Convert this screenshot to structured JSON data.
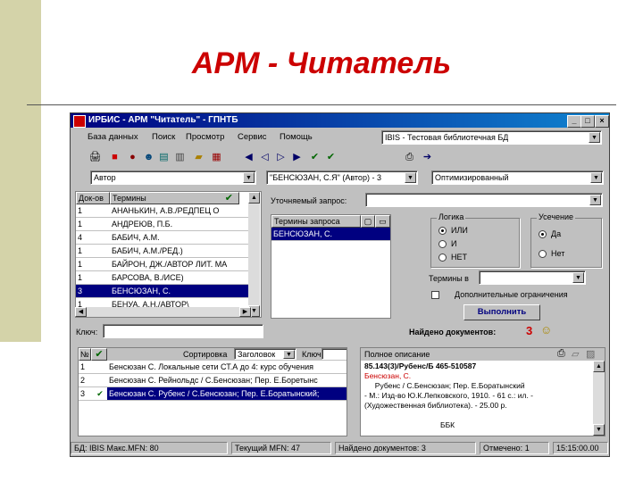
{
  "slide": {
    "title": "АРМ - Читатель"
  },
  "window": {
    "title": "ИРБИС - АРМ \"Читатель\" - ГПНТБ",
    "buttons": {
      "minimize": "_",
      "maximize": "□",
      "close": "×"
    }
  },
  "menu": {
    "items": [
      "База данных",
      "Поиск",
      "Просмотр",
      "Сервис",
      "Помощь"
    ],
    "db_combo": "IBIS - Тестовая библиотечная БД"
  },
  "toolbar": {
    "icons": [
      "printer-icon",
      "car-icon",
      "record-icon",
      "users-icon",
      "db-icon",
      "book-icon",
      "folder-icon",
      "books-icon",
      "arrow-left-icon",
      "arrow-left2-icon",
      "arrow-right-icon",
      "arrow-right2-icon",
      "check-icon",
      "check2-icon",
      "print-icon",
      "export-icon"
    ]
  },
  "search": {
    "prefix_combo": "Автор",
    "query_combo": "\"БЕНСЮЗАН, С.Я\" (Автор) - 3",
    "mode_combo": "Оптимизированный"
  },
  "dictionary": {
    "headers": {
      "count": "Док-ов",
      "terms": "Термины"
    },
    "rows": [
      {
        "count": "1",
        "term": "АНАНЬКИН, А.В./РЕДПЕЦ О"
      },
      {
        "count": "1",
        "term": "АНДРЕЮВ, П.Б."
      },
      {
        "count": "4",
        "term": "БАБИЧ, А.М."
      },
      {
        "count": "1",
        "term": "БАБИЧ, А.М./РЕД.)"
      },
      {
        "count": "1",
        "term": "БАЙРОН, ДЖ./АВТОР ЛИТ. МА"
      },
      {
        "count": "1",
        "term": "БАРСОВА, В./ИСЕ)"
      },
      {
        "count": "3",
        "term": "БЕНСЮЗАН, С.",
        "selected": true
      },
      {
        "count": "1",
        "term": "БЕНУА, А.Н./АВТОР\\"
      }
    ]
  },
  "key_field": {
    "label": "Ключ:",
    "value": ""
  },
  "query": {
    "refined_label": "Уточняемый запрос:",
    "terms_header": "Термины запроса",
    "terms": [
      "БЕНСЮЗАН, С."
    ],
    "logic_group": {
      "label": "Логика",
      "options": [
        "ИЛИ",
        "И",
        "НЕТ"
      ],
      "selected": "ИЛИ"
    },
    "trunc_group": {
      "label": "Усечение",
      "options": [
        "Да",
        "Нет"
      ],
      "selected": "Да"
    },
    "terms_in_label": "Термины в",
    "extra_limits_label": "Дополнительные ограничения",
    "execute_label": "Выполнить",
    "found_label": "Найдено документов:",
    "found_count": "3"
  },
  "results": {
    "header_no": "№",
    "sort_label": "Сортировка",
    "sort_value": "Заголовок",
    "key_label": "Ключ",
    "rows": [
      {
        "no": "1",
        "text": "Бенсюзан С. Локальные сети СТ.А до 4: курс обучения"
      },
      {
        "no": "2",
        "text": "Бенсюзан С. Рейнольдс / С.Бенсюзан; Пер. Е.Боретынс"
      },
      {
        "no": "3",
        "text": "Бенсюзан С. Рубенс / С.Бенсюзан; Пер. Е.Боратынский;",
        "checked": true,
        "selected": true
      }
    ]
  },
  "full_description": {
    "label": "Полное описание",
    "lines": [
      {
        "text": "85.143(3)/Рубенс/Б 465-510587",
        "bold": true
      },
      {
        "text": "Бенсюзан, С.",
        "red": true
      },
      {
        "text": "     Рубенс / С.Бенсюзан; Пер. Е.Боратынский"
      },
      {
        "text": "- М.: Изд-во Ю.К.Лепковского, 1910. - 61 с.: ил. -"
      },
      {
        "text": "(Художественная библиотека). - 25.00 р."
      },
      {
        "text": ""
      },
      {
        "text": "                                    ББК"
      }
    ]
  },
  "status": {
    "db": "БД: IBIS Макс.MFN: 80",
    "mfn": "Текущий MFN: 47",
    "found": "Найдено документов: 3",
    "marked": "Отмечено: 1",
    "time": "15:15:00.00"
  },
  "colors": {
    "accent": "#000080",
    "title_red": "#cc0000",
    "slide_bar": "#d4d3a9",
    "window_bg": "#c0c0c0"
  }
}
